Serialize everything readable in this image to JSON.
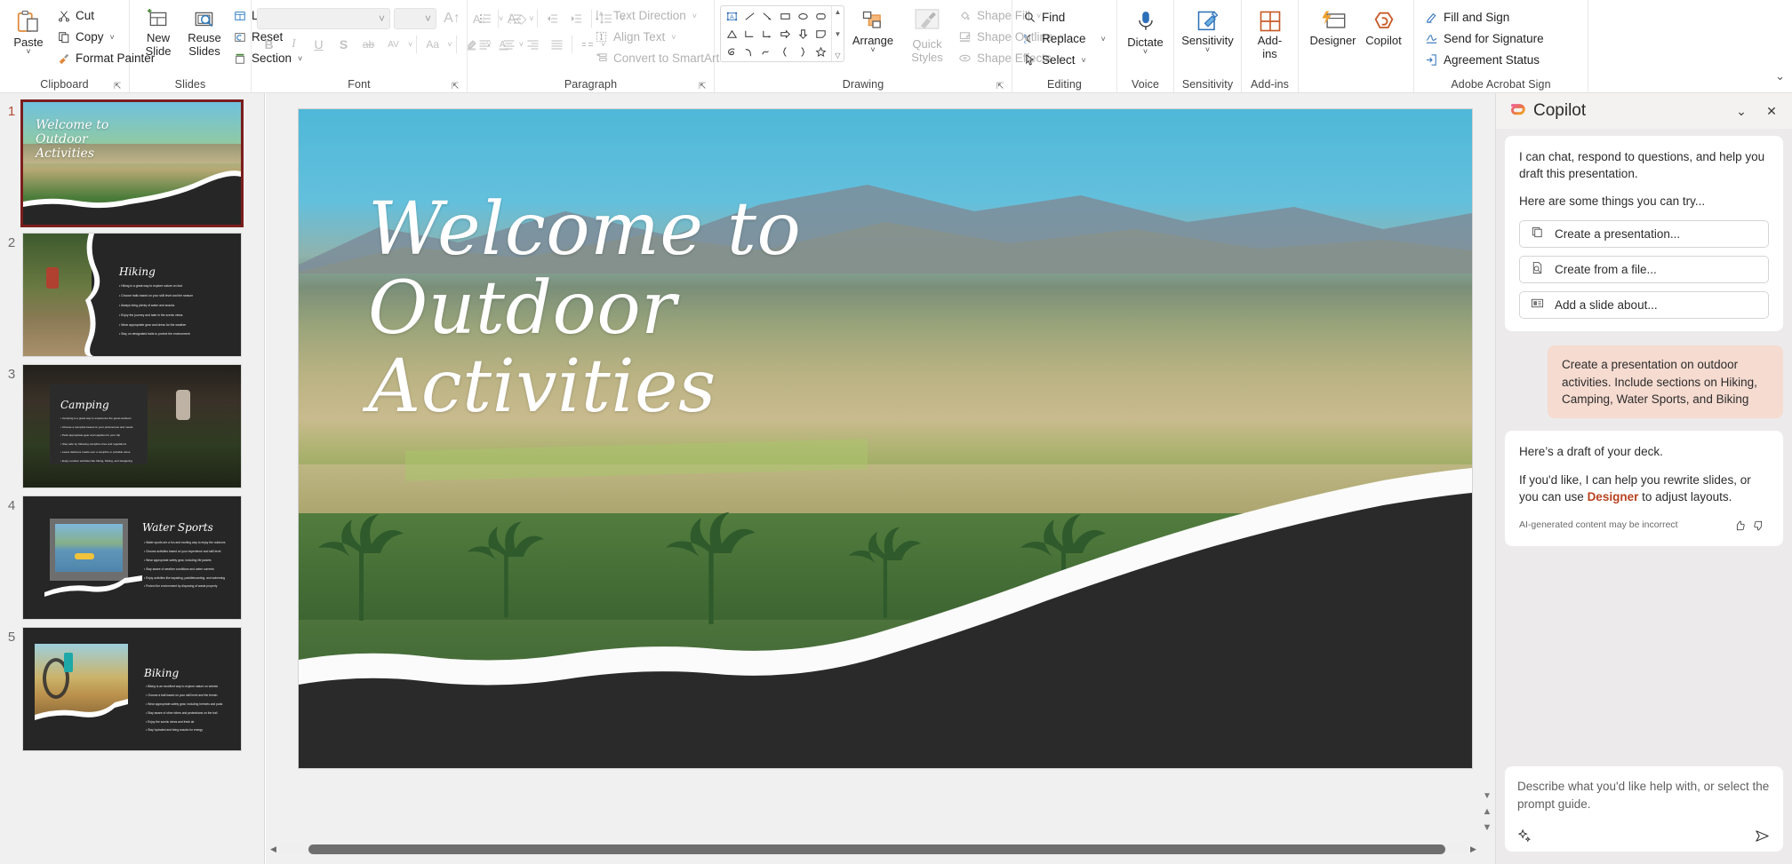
{
  "ribbon": {
    "groups": [
      {
        "name": "clipboard",
        "label": "Clipboard",
        "paste_label": "Paste",
        "items": [
          {
            "label": "Cut",
            "icon": "scissors-icon"
          },
          {
            "label": "Copy",
            "icon": "copy-icon"
          },
          {
            "label": "Format Painter",
            "icon": "format-painter-icon"
          }
        ]
      },
      {
        "name": "slides",
        "label": "Slides",
        "new_slide_label": "New\nSlide",
        "reuse_slides_label": "Reuse\nSlides",
        "items": [
          {
            "label": "Layout",
            "icon": "layout-icon"
          },
          {
            "label": "Reset",
            "icon": "reset-icon"
          },
          {
            "label": "Section",
            "icon": "section-icon"
          }
        ]
      },
      {
        "name": "font",
        "label": "Font",
        "font_name_value": "",
        "font_size_value": "",
        "buttons": [
          "B",
          "I",
          "U",
          "S",
          "ab",
          "AV",
          "Aa"
        ]
      },
      {
        "name": "paragraph",
        "label": "Paragraph",
        "items": [
          {
            "label": "Text Direction",
            "icon": "text-direction-icon"
          },
          {
            "label": "Align Text",
            "icon": "align-text-icon"
          },
          {
            "label": "Convert to SmartArt",
            "icon": "smartart-icon"
          }
        ]
      },
      {
        "name": "drawing",
        "label": "Drawing",
        "arrange_label": "Arrange",
        "quick_styles_label": "Quick\nStyles",
        "items": [
          {
            "label": "Shape Fill",
            "icon": "shape-fill-icon"
          },
          {
            "label": "Shape Outline",
            "icon": "shape-outline-icon"
          },
          {
            "label": "Shape Effects",
            "icon": "shape-effects-icon"
          }
        ]
      },
      {
        "name": "editing",
        "label": "Editing",
        "items": [
          {
            "label": "Find",
            "icon": "search-icon"
          },
          {
            "label": "Replace",
            "icon": "replace-icon"
          },
          {
            "label": "Select",
            "icon": "cursor-icon"
          }
        ]
      },
      {
        "name": "voice",
        "label": "Voice",
        "button_label": "Dictate",
        "icon": "microphone-icon"
      },
      {
        "name": "sensitivity",
        "label": "Sensitivity",
        "button_label": "Sensitivity",
        "icon": "sensitivity-icon"
      },
      {
        "name": "addins",
        "label": "Add-ins",
        "button_label": "Add-ins",
        "icon": "addins-grid-icon"
      },
      {
        "name": "designer-copilot",
        "label": "",
        "designer_label": "Designer",
        "copilot_label": "Copilot"
      },
      {
        "name": "adobe",
        "label": "Adobe Acrobat Sign",
        "items": [
          {
            "label": "Fill and Sign",
            "icon": "pen-icon"
          },
          {
            "label": "Send for Signature",
            "icon": "signature-icon"
          },
          {
            "label": "Agreement Status",
            "icon": "agreement-icon"
          }
        ]
      }
    ],
    "collapse_ribbon_label": "⌄"
  },
  "thumbnails": {
    "selected_index": 1,
    "slides": [
      {
        "number": "1",
        "title": "Welcome to\nOutdoor\nActivities",
        "type": "title-photo",
        "bullets": []
      },
      {
        "number": "2",
        "title": "Hiking",
        "type": "photo-left",
        "bullets": [
          "Hiking is a great way to explore nature on foot",
          "Choose trails based on your skill level and the season",
          "Always bring plenty of water and snacks",
          "Enjoy the journey and take in the scenic views",
          "Wear appropriate gear and dress for the weather",
          "Stay on designated trails to protect the environment"
        ]
      },
      {
        "number": "3",
        "title": "Camping",
        "type": "photo-bg",
        "bullets": [
          "Camping is a great way to experience the great outdoors",
          "Choose a campsite based on your preferences and needs",
          "Pack appropriate gear and supplies for your trip",
          "Stay safe by following campfire rules and regulations",
          "Leave delicious meals over a campfire or portable stove",
          "Enjoy outdoor activities like hiking, fishing, and stargazing"
        ]
      },
      {
        "number": "4",
        "title": "Water Sports",
        "type": "photo-left-card",
        "bullets": [
          "Water sports are a fun and exciting way to enjoy the outdoors",
          "Choose activities based on your experience and skill level",
          "Wear appropriate safety gear, including life jackets",
          "Stay aware of weather conditions and water currents",
          "Enjoy activities like kayaking, paddleboarding, and swimming",
          "Protect the environment by disposing of waste properly"
        ]
      },
      {
        "number": "5",
        "title": "Biking",
        "type": "photo-left-card",
        "bullets": [
          "Biking is an excellent way to explore nature on wheels",
          "Choose a trail based on your skill level and the terrain",
          "Wear appropriate safety gear, including helmets and pads",
          "Stay aware of other riders and pedestrians on the trail",
          "Enjoy the scenic views and fresh air",
          "Stay hydrated and bring snacks for energy"
        ]
      }
    ]
  },
  "slide": {
    "title": "Welcome to\nOutdoor\nActivities"
  },
  "copilot": {
    "title": "Copilot",
    "minimize_label": "⌄",
    "close_label": "✕",
    "intro_line1": "I can chat, respond to questions, and help you draft this presentation.",
    "intro_line2": "Here are some things you can try...",
    "suggestions": [
      {
        "label": "Create a presentation...",
        "icon": "slides-stack-icon"
      },
      {
        "label": "Create from a file...",
        "icon": "file-search-icon"
      },
      {
        "label": "Add a slide about...",
        "icon": "add-slide-icon"
      }
    ],
    "user_message": "Create a presentation on outdoor activities. Include sections on Hiking, Camping, Water Sports, and Biking",
    "reply_line1": "Here’s a draft of your deck.",
    "reply_line2_pre": "If you'd like, I can help you rewrite slides, or you can use ",
    "reply_link": "Designer",
    "reply_line2_post": " to adjust layouts.",
    "disclaimer": "AI-generated content may be incorrect",
    "thumbs_up": "👍",
    "thumbs_down": "👎",
    "input_placeholder": "Describe what you'd like help with, or select the prompt guide.",
    "prompt_guide_icon": "sparkle-icon",
    "send_icon": "send-icon"
  },
  "scrollbars": {
    "h_left_arrow": "◀",
    "h_right_arrow": "▶",
    "v_prev": "▲",
    "v_next": "▼",
    "v_menu": "▼"
  },
  "colors": {
    "accent_red": "#b8431f",
    "user_bubble": "#f6dbd0",
    "selection_border": "#7b1d1d",
    "panel_bg": "#f0f0f0"
  }
}
